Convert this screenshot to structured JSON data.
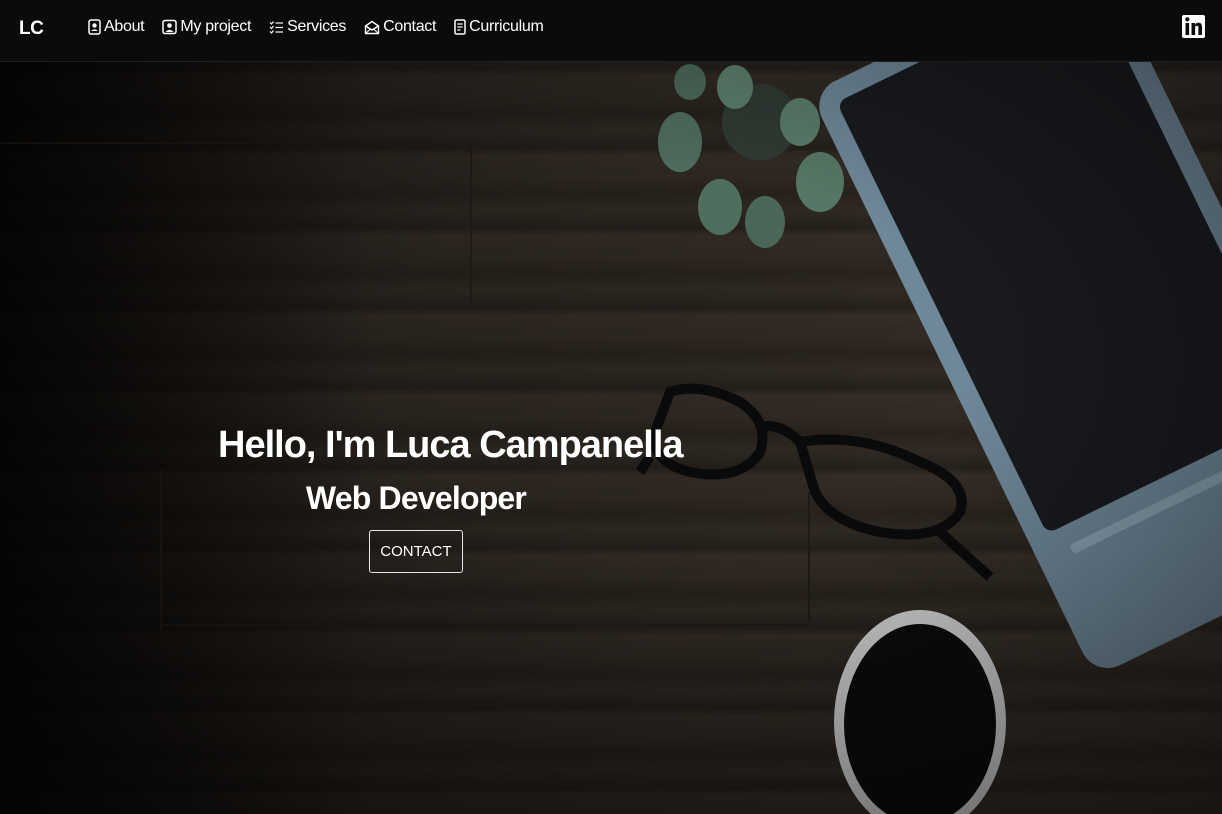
{
  "navbar": {
    "brand": "LC",
    "items": [
      {
        "label": "About",
        "icon": "person-badge-icon"
      },
      {
        "label": "My project",
        "icon": "person-square-icon"
      },
      {
        "label": "Services",
        "icon": "list-check-icon"
      },
      {
        "label": "Contact",
        "icon": "envelope-open-icon"
      },
      {
        "label": "Curriculum",
        "icon": "file-text-icon"
      }
    ],
    "social": {
      "icon": "linkedin-icon"
    }
  },
  "hero": {
    "title": "Hello, I'm Luca Campanella",
    "subtitle": "Web Developer",
    "button_label": "CONTACT"
  },
  "colors": {
    "navbar_bg": "#0b0b0b",
    "text": "#ffffff",
    "laptop": "#6f8899",
    "plant": "#4e6b5c"
  }
}
